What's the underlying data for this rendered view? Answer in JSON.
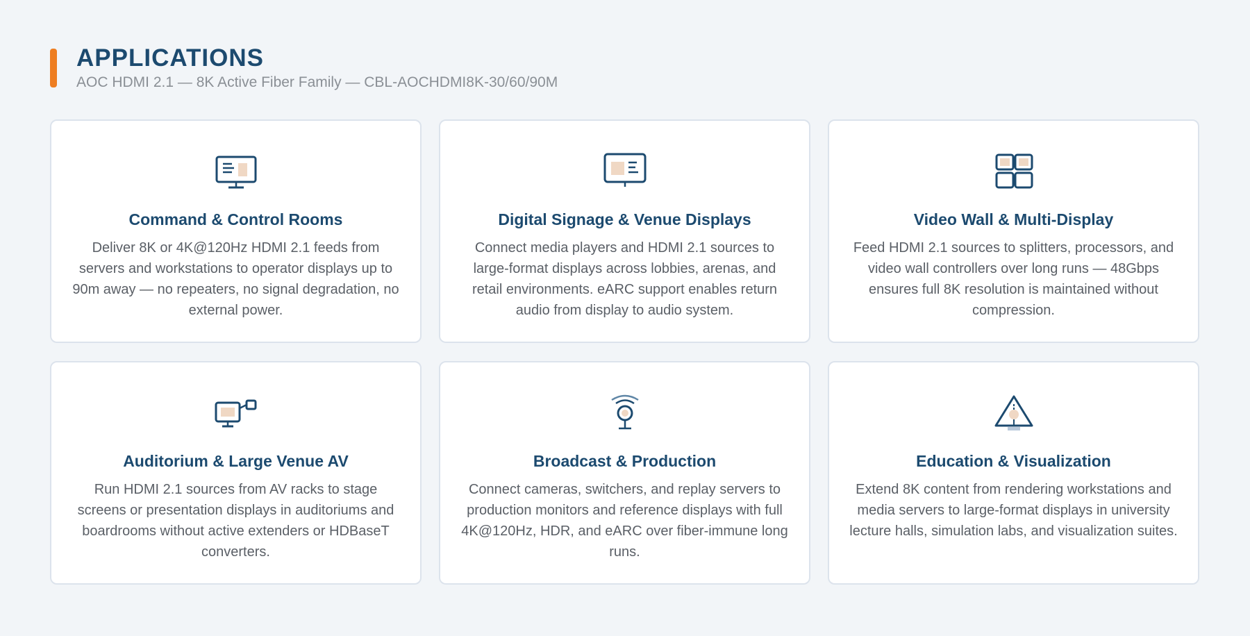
{
  "header": {
    "title": "APPLICATIONS",
    "subtitle": "AOC HDMI 2.1 — 8K Active Fiber Family — CBL-AOCHDMI8K-30/60/90M"
  },
  "colors": {
    "accent": "#ee7e22",
    "primary": "#1c4a6f",
    "icon_fill": "#f0d8c4",
    "background": "#f2f5f8"
  },
  "cards": [
    {
      "icon": "monitor-icon",
      "title": "Command & Control Rooms",
      "description": "Deliver 8K or 4K@120Hz HDMI 2.1 feeds from servers and workstations to operator displays up to 90m away — no repeaters, no signal degradation, no external power."
    },
    {
      "icon": "signage-display-icon",
      "title": "Digital Signage & Venue Displays",
      "description": "Connect media players and HDMI 2.1 sources to large-format displays across lobbies, arenas, and retail environments. eARC support enables return audio from display to audio system."
    },
    {
      "icon": "video-wall-grid-icon",
      "title": "Video Wall & Multi-Display",
      "description": "Feed HDMI 2.1 sources to splitters, processors, and video wall controllers over long runs — 48Gbps ensures full 8K resolution is maintained without compression."
    },
    {
      "icon": "projector-display-icon",
      "title": "Auditorium & Large Venue AV",
      "description": "Run HDMI 2.1 sources from AV racks to stage screens or presentation displays in auditoriums and boardrooms without active extenders or HDBaseT converters."
    },
    {
      "icon": "broadcast-camera-icon",
      "title": "Broadcast & Production",
      "description": "Connect cameras, switchers, and replay servers to production monitors and reference displays with full 4K@120Hz, HDR, and eARC over fiber-immune long runs."
    },
    {
      "icon": "education-visualization-icon",
      "title": "Education & Visualization",
      "description": "Extend 8K content from rendering workstations and media servers to large-format displays in university lecture halls, simulation labs, and visualization suites."
    }
  ]
}
